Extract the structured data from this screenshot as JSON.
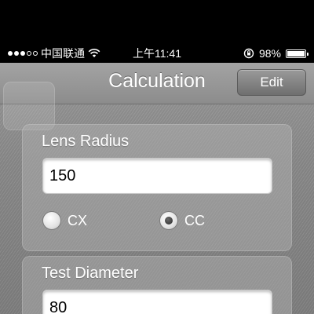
{
  "status_bar": {
    "carrier": "中国联通",
    "time": "上午11:41",
    "battery_text": "98%",
    "battery_level": 0.98,
    "signal_bars": 5,
    "signal_filled": 3,
    "icons": [
      "wifi-icon",
      "rotation-lock-icon",
      "battery-icon"
    ]
  },
  "nav": {
    "title": "Calculation",
    "edit_label": "Edit"
  },
  "lens_radius": {
    "label": "Lens Radius",
    "value": "150",
    "options": [
      {
        "label": "CX",
        "selected": false
      },
      {
        "label": "CC",
        "selected": true
      }
    ]
  },
  "test_diameter": {
    "label": "Test Diameter",
    "value": "80"
  }
}
